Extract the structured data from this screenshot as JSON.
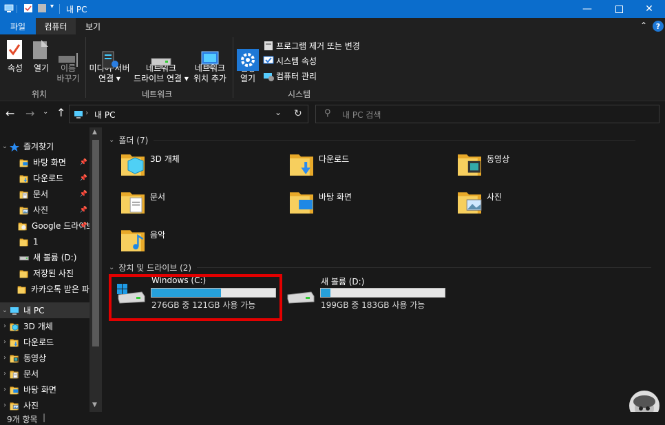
{
  "window": {
    "title": "내 PC"
  },
  "tabs": [
    {
      "label": "파일"
    },
    {
      "label": "컴퓨터"
    },
    {
      "label": "보기"
    }
  ],
  "ribbon": {
    "location": {
      "group": "위치",
      "buttons": [
        {
          "label": "속성"
        },
        {
          "label": "열기"
        },
        {
          "label": "이름\n바꾸기"
        }
      ]
    },
    "network": {
      "group": "네트워크",
      "buttons": [
        {
          "label": "미디어 서버\n연결 ▾"
        },
        {
          "label": "네트워크\n드라이브 연결 ▾"
        },
        {
          "label": "네트워크\n위치 추가"
        }
      ]
    },
    "system": {
      "group": "시스템",
      "settings_label": "설정\n열기",
      "items": [
        {
          "label": "프로그램 제거 또는 변경"
        },
        {
          "label": "시스템 속성"
        },
        {
          "label": "컴퓨터 관리"
        }
      ]
    }
  },
  "address": {
    "path": "내 PC",
    "search_placeholder": "내 PC 검색"
  },
  "nav": {
    "quick_access": "즐겨찾기",
    "quick_items": [
      {
        "label": "바탕 화면",
        "icon": "desktop-icon"
      },
      {
        "label": "다운로드",
        "icon": "download-icon"
      },
      {
        "label": "문서",
        "icon": "document-icon"
      },
      {
        "label": "사진",
        "icon": "pictures-icon"
      },
      {
        "label": "Google 드라이브",
        "icon": "google-drive-icon"
      },
      {
        "label": "1",
        "icon": "folder-icon"
      },
      {
        "label": "새 볼륨 (D:)",
        "icon": "drive-icon"
      },
      {
        "label": "저장된 사진",
        "icon": "folder-icon"
      },
      {
        "label": "카카오톡 받은 파일",
        "icon": "folder-icon"
      }
    ],
    "this_pc": "내 PC",
    "pc_items": [
      {
        "label": "3D 개체",
        "icon": "3d-objects-icon"
      },
      {
        "label": "다운로드",
        "icon": "download-icon"
      },
      {
        "label": "동영상",
        "icon": "videos-icon"
      },
      {
        "label": "문서",
        "icon": "document-icon"
      },
      {
        "label": "바탕 화면",
        "icon": "desktop-icon"
      },
      {
        "label": "사진",
        "icon": "pictures-icon"
      }
    ]
  },
  "content": {
    "folders_header": "폴더 (7)",
    "folders": [
      {
        "label": "3D 개체",
        "icon": "3d-objects-icon"
      },
      {
        "label": "다운로드",
        "icon": "download-icon"
      },
      {
        "label": "동영상",
        "icon": "videos-icon"
      },
      {
        "label": "문서",
        "icon": "document-icon"
      },
      {
        "label": "바탕 화면",
        "icon": "desktop-icon"
      },
      {
        "label": "사진",
        "icon": "pictures-icon"
      },
      {
        "label": "음악",
        "icon": "music-icon"
      }
    ],
    "drives_header": "장치 및 드라이브 (2)",
    "drives": [
      {
        "label": "Windows (C:)",
        "detail": "276GB 중 121GB 사용 가능",
        "used_fraction": 0.56,
        "highlighted": true
      },
      {
        "label": "새 볼륨 (D:)",
        "detail": "199GB 중 183GB 사용 가능",
        "used_fraction": 0.08,
        "highlighted": false
      }
    ]
  },
  "status": {
    "count": "9개 항목"
  },
  "colors": {
    "accent": "#0b6dcc",
    "bar_fill": "#26a0da",
    "folder": "#f3c34a",
    "highlight": "#e30000"
  }
}
